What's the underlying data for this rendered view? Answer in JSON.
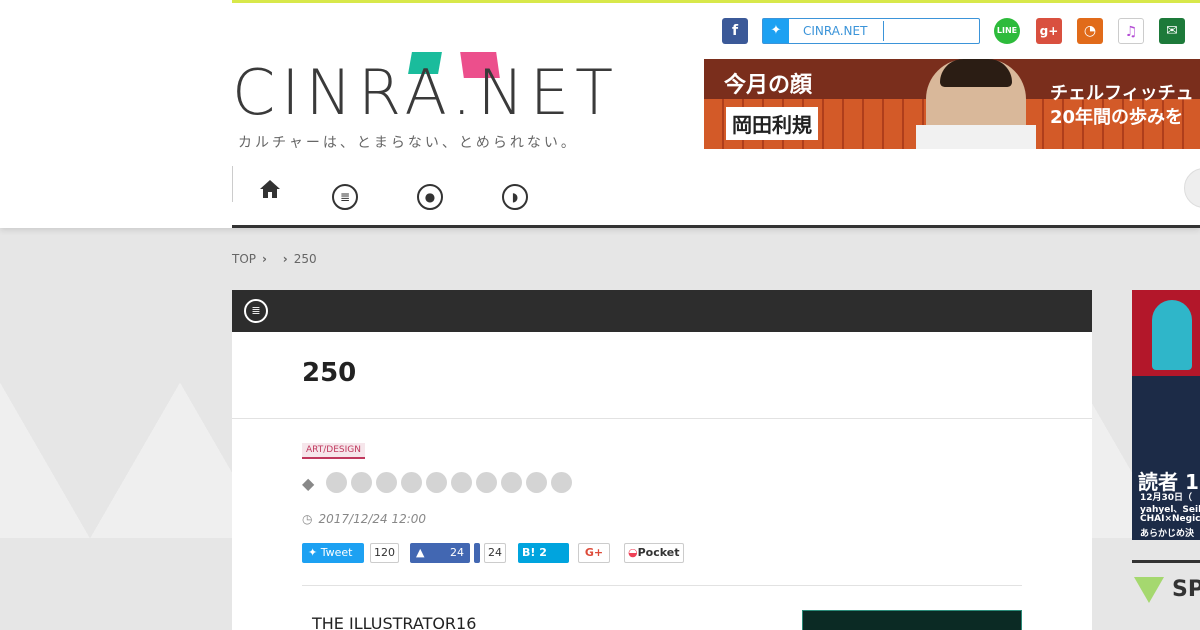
{
  "header": {
    "logo_text": "CINRA.NET",
    "tagline": "カルチャーは、とまらない、とめられない。",
    "social": {
      "twitter_label": "CINRA.NET",
      "icons": [
        "facebook-icon",
        "twitter-icon",
        "line-icon",
        "google-plus-icon",
        "rss-icon",
        "itunes-icon",
        "mail-icon"
      ]
    },
    "banner": {
      "heading": "今月の顔",
      "name": "岡田利規",
      "line1": "チェルフィッチュ",
      "line2": "20年間の歩みを"
    },
    "nav": {
      "items": [
        "home-icon",
        "news-icon",
        "people-icon",
        "interview-icon"
      ]
    }
  },
  "breadcrumb": {
    "top": "TOP",
    "current": "250"
  },
  "article": {
    "title": "250",
    "category": "ART/DESIGN",
    "tag_count": 10,
    "date": "2017/12/24 12:00",
    "share": {
      "tweet_label": "Tweet",
      "tweet_count": "120",
      "like_count": "24",
      "share_count": "24",
      "hatena_label": "B! 2",
      "gplus_label": "G+",
      "pocket_label": "Pocket"
    },
    "lead": "THE ILLUSTRATOR16"
  },
  "sidebar": {
    "ad_heading": "読者 1",
    "ad_line1": "12月30日（",
    "ad_line2": "yahyel、Seih",
    "ad_line3": "CHAI×Negic",
    "ad_line4": "あらかじめ決",
    "section_label": "SP"
  },
  "colors": {
    "accent_line": "#d8e84a",
    "teal": "#1abc9c",
    "pink": "#ec4f8c",
    "category": "#c0395e",
    "twitter": "#1da1f2",
    "facebook": "#3b5998"
  }
}
